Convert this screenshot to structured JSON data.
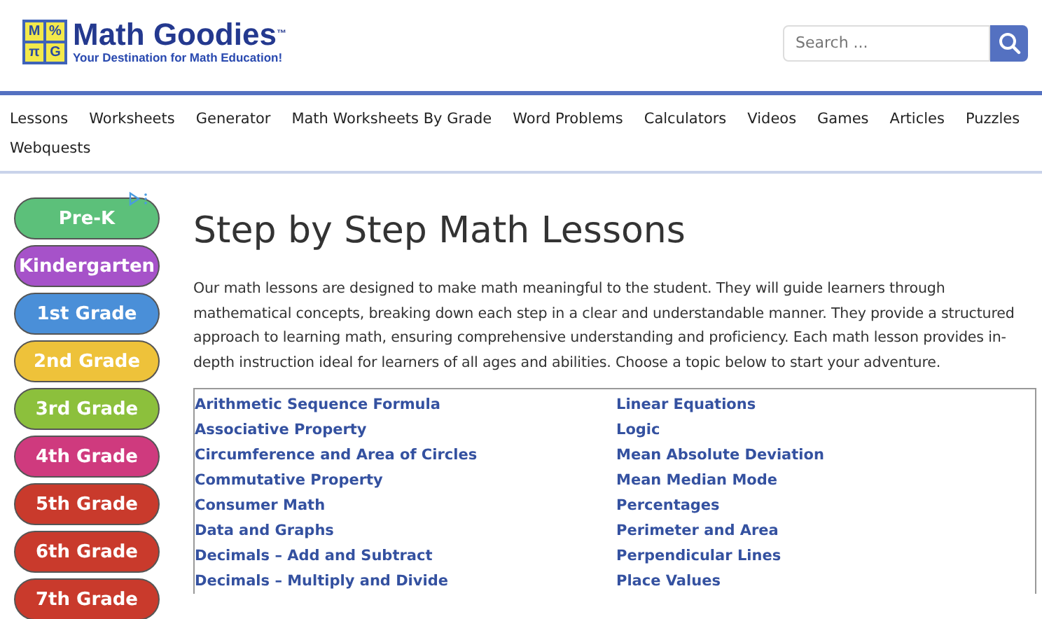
{
  "logo": {
    "tiles": [
      "M",
      "%",
      "π",
      "G"
    ],
    "name": "Math Goodies",
    "trademark": "™",
    "tagline": "Your Destination for Math Education!"
  },
  "search": {
    "placeholder": "Search ..."
  },
  "nav": [
    "Lessons",
    "Worksheets",
    "Generator",
    "Math Worksheets By Grade",
    "Word Problems",
    "Calculators",
    "Videos",
    "Games",
    "Articles",
    "Puzzles",
    "Webquests"
  ],
  "grades": [
    {
      "label": "Pre-K",
      "color": "#5cc07a"
    },
    {
      "label": "Kindergarten",
      "color": "#a652c9"
    },
    {
      "label": "1st Grade",
      "color": "#4a8fd8"
    },
    {
      "label": "2nd Grade",
      "color": "#eec23a"
    },
    {
      "label": "3rd Grade",
      "color": "#8cc03c"
    },
    {
      "label": "4th Grade",
      "color": "#cf3a7e"
    },
    {
      "label": "5th Grade",
      "color": "#c93a2c"
    },
    {
      "label": "6th Grade",
      "color": "#c93a2c"
    },
    {
      "label": "7th Grade",
      "color": "#c93a2c"
    }
  ],
  "title": "Step by Step Math Lessons",
  "intro": "Our math lessons are designed to make math meaningful to the student. They will guide learners through mathematical concepts, breaking down each step in a clear and understandable manner. They provide a structured approach to learning math, ensuring comprehensive understanding and proficiency. Each math lesson provides in-depth instruction ideal for learners of all ages and abilities. Choose a topic below to start your adventure.",
  "topics": {
    "column_1": [
      "Arithmetic Sequence Formula",
      "Associative Property",
      "Circumference and Area of Circles",
      "Commutative Property",
      "Consumer Math",
      "Data and Graphs",
      "Decimals – Add and Subtract",
      "Decimals – Multiply and Divide"
    ],
    "column_2": [
      "Linear Equations",
      "Logic",
      "Mean Absolute Deviation",
      "Mean Median Mode",
      "Percentages",
      "Perimeter and Area",
      "Perpendicular Lines",
      "Place Values"
    ]
  }
}
